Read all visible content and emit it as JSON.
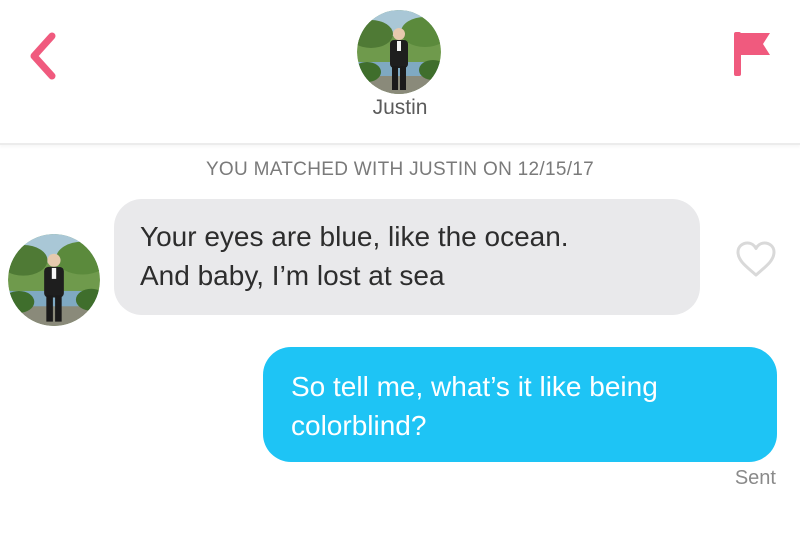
{
  "header": {
    "match_name": "Justin",
    "back_icon": "chevron-left-icon",
    "report_icon": "flag-icon",
    "accent_color": "#f05a7e"
  },
  "match_notice": "YOU MATCHED WITH JUSTIN ON 12/15/17",
  "messages": [
    {
      "direction": "incoming",
      "lines": [
        "Your eyes are blue, like the ocean.",
        "And baby, I’m lost at sea"
      ],
      "bubble_color": "#e9e9eb",
      "like_icon": "heart-outline-icon"
    },
    {
      "direction": "outgoing",
      "lines": [
        "So tell me, what’s it like being",
        "colorblind?"
      ],
      "bubble_color": "#1ec4f5",
      "status": "Sent"
    }
  ]
}
